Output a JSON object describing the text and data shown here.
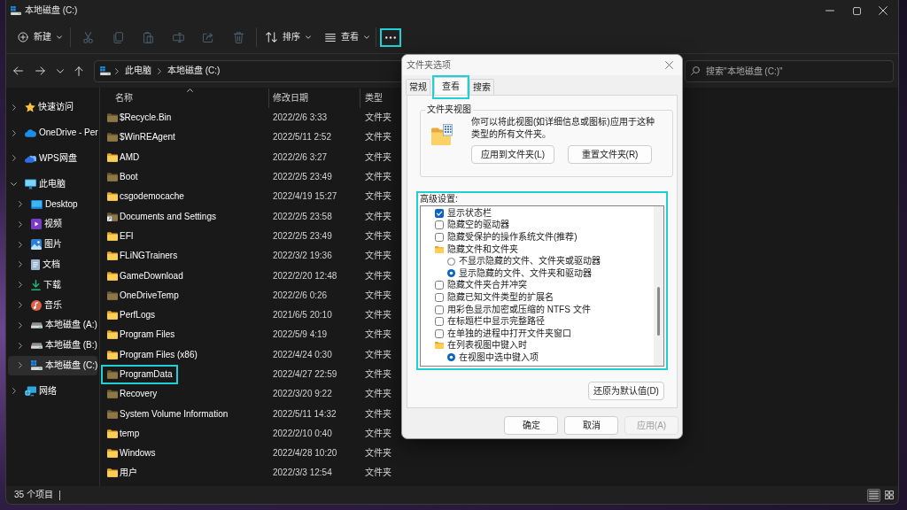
{
  "window": {
    "title": "本地磁盘 (C:)"
  },
  "toolbar": {
    "new_button": {
      "label": "新建"
    },
    "actions": [
      {
        "disabled": true
      },
      {
        "disabled": true
      },
      {
        "disabled": true
      },
      {
        "disabled": true
      },
      {
        "disabled": true
      },
      {
        "disabled": true
      }
    ],
    "sort_button": {
      "label": "排序"
    },
    "view_button": {
      "label": "查看"
    },
    "more_button": {
      "highlighted": true
    }
  },
  "address_bar": {
    "path": [
      "此电脑",
      "本地磁盘 (C:)"
    ]
  },
  "search": {
    "placeholder": "搜索\"本地磁盘 (C:)\""
  },
  "sidebar": {
    "items": [
      {
        "kind": "quick",
        "label": "快速访问",
        "expanded": false,
        "selected": false
      },
      {
        "kind": "onedrive",
        "label": "OneDrive - Per",
        "expanded": false,
        "selected": false
      },
      {
        "kind": "wps",
        "label": "WPS网盘",
        "expanded": false,
        "selected": false
      },
      {
        "kind": "pc",
        "label": "此电脑",
        "expanded": true,
        "selected": false,
        "children": [
          {
            "kind": "desktop",
            "label": "Desktop",
            "expanded": false,
            "selected": false
          },
          {
            "kind": "videos",
            "label": "视频",
            "expanded": false,
            "selected": false
          },
          {
            "kind": "pictures",
            "label": "图片",
            "expanded": false,
            "selected": false
          },
          {
            "kind": "documents",
            "label": "文档",
            "expanded": false,
            "selected": false
          },
          {
            "kind": "downloads",
            "label": "下载",
            "expanded": false,
            "selected": false
          },
          {
            "kind": "music",
            "label": "音乐",
            "expanded": false,
            "selected": false
          },
          {
            "kind": "drive",
            "label": "本地磁盘 (A:)",
            "expanded": false,
            "selected": false
          },
          {
            "kind": "drive",
            "label": "本地磁盘 (B:)",
            "expanded": false,
            "selected": false
          },
          {
            "kind": "sysdrive",
            "label": "本地磁盘 (C:)",
            "expanded": false,
            "selected": true
          }
        ]
      },
      {
        "kind": "network",
        "label": "网络",
        "expanded": false,
        "selected": false
      }
    ]
  },
  "file_list": {
    "columns": [
      {
        "label": "名称",
        "sorted": true
      },
      {
        "label": "修改日期",
        "sorted": false
      },
      {
        "label": "类型",
        "sorted": false
      }
    ],
    "rows": [
      {
        "name": "$Recycle.Bin",
        "modified": "2022/2/6 3:33",
        "type": "文件夹",
        "hidden": true,
        "shortcut": false,
        "highlighted": false
      },
      {
        "name": "$WinREAgent",
        "modified": "2022/5/11 2:52",
        "type": "文件夹",
        "hidden": true,
        "shortcut": false,
        "highlighted": false
      },
      {
        "name": "AMD",
        "modified": "2022/2/6 3:27",
        "type": "文件夹",
        "hidden": false,
        "shortcut": false,
        "highlighted": false
      },
      {
        "name": "Boot",
        "modified": "2022/2/5 23:49",
        "type": "文件夹",
        "hidden": true,
        "shortcut": false,
        "highlighted": false
      },
      {
        "name": "csgodemocache",
        "modified": "2022/4/19 15:27",
        "type": "文件夹",
        "hidden": false,
        "shortcut": false,
        "highlighted": false
      },
      {
        "name": "Documents and Settings",
        "modified": "2022/2/5 23:58",
        "type": "文件夹",
        "hidden": true,
        "shortcut": true,
        "highlighted": false
      },
      {
        "name": "EFI",
        "modified": "2022/2/5 23:49",
        "type": "文件夹",
        "hidden": false,
        "shortcut": false,
        "highlighted": false
      },
      {
        "name": "FLiNGTrainers",
        "modified": "2022/3/2 19:36",
        "type": "文件夹",
        "hidden": false,
        "shortcut": false,
        "highlighted": false
      },
      {
        "name": "GameDownload",
        "modified": "2022/2/20 12:48",
        "type": "文件夹",
        "hidden": false,
        "shortcut": false,
        "highlighted": false
      },
      {
        "name": "OneDriveTemp",
        "modified": "2022/2/6 0:26",
        "type": "文件夹",
        "hidden": true,
        "shortcut": false,
        "highlighted": false
      },
      {
        "name": "PerfLogs",
        "modified": "2021/6/5 20:10",
        "type": "文件夹",
        "hidden": false,
        "shortcut": false,
        "highlighted": false
      },
      {
        "name": "Program Files",
        "modified": "2022/5/9 4:19",
        "type": "文件夹",
        "hidden": false,
        "shortcut": false,
        "highlighted": false
      },
      {
        "name": "Program Files (x86)",
        "modified": "2022/4/24 0:30",
        "type": "文件夹",
        "hidden": false,
        "shortcut": false,
        "highlighted": false
      },
      {
        "name": "ProgramData",
        "modified": "2022/4/27 22:59",
        "type": "文件夹",
        "hidden": true,
        "shortcut": false,
        "highlighted": true
      },
      {
        "name": "Recovery",
        "modified": "2022/3/20 9:22",
        "type": "文件夹",
        "hidden": true,
        "shortcut": false,
        "highlighted": false
      },
      {
        "name": "System Volume Information",
        "modified": "2022/5/11 14:32",
        "type": "文件夹",
        "hidden": true,
        "shortcut": false,
        "highlighted": false
      },
      {
        "name": "temp",
        "modified": "2022/2/10 0:40",
        "type": "文件夹",
        "hidden": false,
        "shortcut": false,
        "highlighted": false
      },
      {
        "name": "Windows",
        "modified": "2022/4/28 10:20",
        "type": "文件夹",
        "hidden": false,
        "shortcut": false,
        "highlighted": false
      },
      {
        "name": "用户",
        "modified": "2022/3/3 12:54",
        "type": "文件夹",
        "hidden": false,
        "shortcut": false,
        "highlighted": false
      }
    ]
  },
  "status_bar": {
    "count": "35 个项目",
    "view_modes": [
      {
        "selected": true
      },
      {
        "selected": false
      }
    ]
  },
  "dialog": {
    "title": "文件夹选项",
    "tabs": [
      {
        "label": "常规",
        "selected": false,
        "highlighted": false
      },
      {
        "label": "查看",
        "selected": true,
        "highlighted": true
      },
      {
        "label": "搜索",
        "selected": false,
        "highlighted": false
      }
    ],
    "folder_views": {
      "title": "文件夹视图",
      "text": "你可以将此视图(如详细信息或图标)应用于这种类型的所有文件夹。",
      "buttons": [
        "应用到文件夹(L)",
        "重置文件夹(R)"
      ]
    },
    "advanced": {
      "label": "高级设置:",
      "highlighted": true,
      "items": [
        {
          "kind": "check",
          "label": "显示状态栏",
          "checked": true
        },
        {
          "kind": "check",
          "label": "隐藏空的驱动器",
          "checked": false
        },
        {
          "kind": "check",
          "label": "隐藏受保护的操作系统文件(推荐)",
          "checked": false
        },
        {
          "kind": "group",
          "label": "隐藏文件和文件夹",
          "children": [
            {
              "kind": "radio",
              "label": "不显示隐藏的文件、文件夹或驱动器",
              "selected": false
            },
            {
              "kind": "radio",
              "label": "显示隐藏的文件、文件夹和驱动器",
              "selected": true
            }
          ]
        },
        {
          "kind": "check",
          "label": "隐藏文件夹合并冲突",
          "checked": false
        },
        {
          "kind": "check",
          "label": "隐藏已知文件类型的扩展名",
          "checked": false
        },
        {
          "kind": "check",
          "label": "用彩色显示加密或压缩的 NTFS 文件",
          "checked": false
        },
        {
          "kind": "check",
          "label": "在标题栏中显示完整路径",
          "checked": false
        },
        {
          "kind": "check",
          "label": "在单独的进程中打开文件夹窗口",
          "checked": false
        },
        {
          "kind": "group",
          "label": "在列表视图中键入时",
          "children": [
            {
              "kind": "radio",
              "label": "在视图中选中键入项",
              "selected": true
            }
          ]
        }
      ]
    },
    "restore_button": {
      "label": "还原为默认值(D)"
    },
    "buttons": [
      {
        "label": "确定",
        "disabled": false
      },
      {
        "label": "取消",
        "disabled": false
      },
      {
        "label": "应用(A)",
        "disabled": true
      }
    ]
  }
}
